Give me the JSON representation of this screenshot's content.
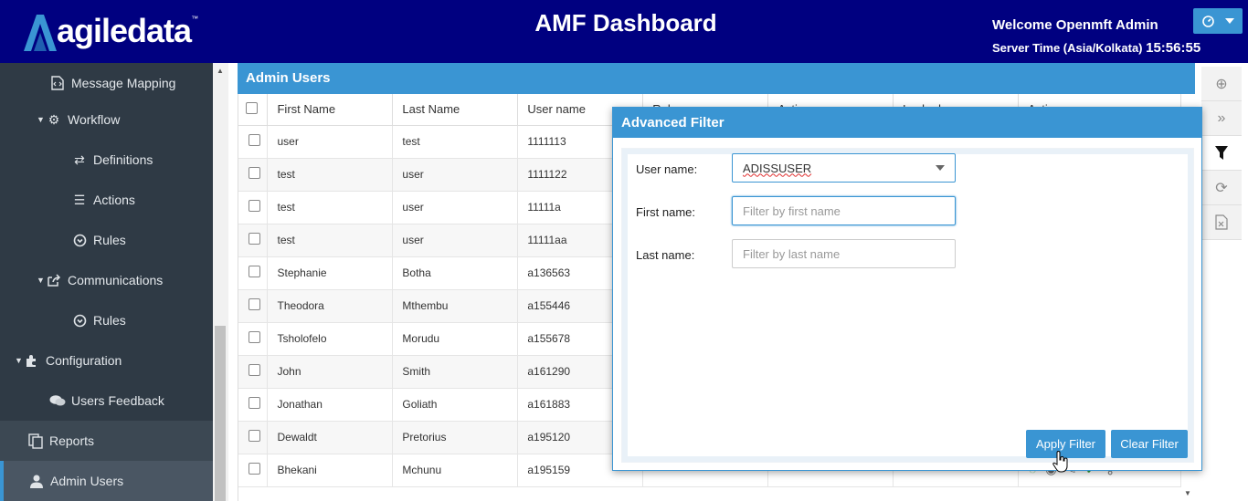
{
  "header": {
    "logo_text": "agiledata",
    "logo_tm": "™",
    "title": "AMF Dashboard",
    "welcome": "Welcome Openmft Admin",
    "server_time_label": "Server Time (Asia/Kolkata)",
    "server_time": "15:56:55"
  },
  "sidebar": {
    "items": [
      {
        "label": "Message Mapping",
        "icon": "file-code-icon"
      },
      {
        "label": "Workflow",
        "icon": "gear-icon"
      },
      {
        "label": "Definitions",
        "icon": "exchange-icon"
      },
      {
        "label": "Actions",
        "icon": "list-icon"
      },
      {
        "label": "Rules",
        "icon": "circle-down-icon"
      },
      {
        "label": "Communications",
        "icon": "share-icon"
      },
      {
        "label": "Rules",
        "icon": "circle-down-icon"
      },
      {
        "label": "Configuration",
        "icon": "puzzle-icon"
      },
      {
        "label": "Users Feedback",
        "icon": "comments-icon"
      },
      {
        "label": "Reports",
        "icon": "copy-icon"
      },
      {
        "label": "Admin Users",
        "icon": "user-icon"
      }
    ]
  },
  "panel": {
    "title": "Admin Users"
  },
  "grid": {
    "columns": [
      "First Name",
      "Last Name",
      "User name",
      "Role",
      "Active",
      "Locked",
      "Actions"
    ],
    "rows": [
      {
        "first": "user",
        "last": "test",
        "username": "1111113"
      },
      {
        "first": "test",
        "last": "user",
        "username": "1111122"
      },
      {
        "first": "test",
        "last": "user",
        "username": "11111a"
      },
      {
        "first": "test",
        "last": "user",
        "username": "11111aa"
      },
      {
        "first": "Stephanie",
        "last": "Botha",
        "username": "a136563"
      },
      {
        "first": "Theodora",
        "last": "Mthembu",
        "username": "a155446"
      },
      {
        "first": "Tsholofelo",
        "last": "Morudu",
        "username": "a155678"
      },
      {
        "first": "John",
        "last": "Smith",
        "username": "a161290"
      },
      {
        "first": "Jonathan",
        "last": "Goliath",
        "username": "a161883"
      },
      {
        "first": "Dewaldt",
        "last": "Pretorius",
        "username": "a195120"
      },
      {
        "first": "Bhekani",
        "last": "Mchunu",
        "username": "a195159"
      }
    ]
  },
  "filter": {
    "title": "Advanced Filter",
    "username_label": "User name:",
    "username_value": "ADISSUSER",
    "firstname_label": "First name:",
    "firstname_placeholder": "Filter by first name",
    "lastname_label": "Last name:",
    "lastname_placeholder": "Filter by last name",
    "apply_label": "Apply Filter",
    "clear_label": "Clear Filter"
  },
  "colors": {
    "header_bg": "#000080",
    "accent": "#3a95d3",
    "sidebar_bg": "#2f3a45"
  }
}
